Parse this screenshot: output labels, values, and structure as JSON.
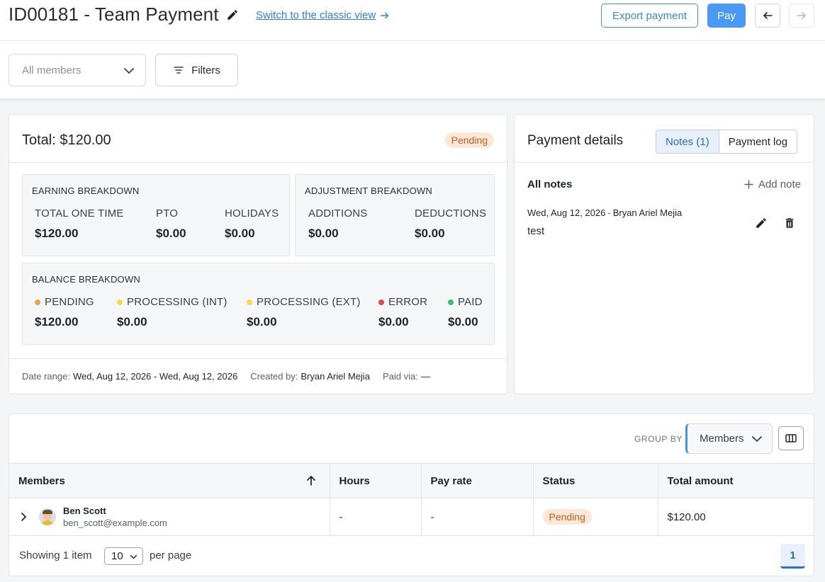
{
  "header": {
    "title": "ID00181 - Team Payment",
    "classic_link": "Switch to the classic view",
    "export_label": "Export payment",
    "pay_label": "Pay"
  },
  "filters": {
    "members_placeholder": "All members",
    "filters_label": "Filters"
  },
  "summary": {
    "total": "Total: $120.00",
    "status": "Pending",
    "earning": {
      "title": "EARNING BREAKDOWN",
      "items": [
        {
          "label": "TOTAL ONE TIME",
          "value": "$120.00"
        },
        {
          "label": "PTO",
          "value": "$0.00"
        },
        {
          "label": "HOLIDAYS",
          "value": "$0.00"
        }
      ]
    },
    "adjustment": {
      "title": "ADJUSTMENT BREAKDOWN",
      "items": [
        {
          "label": "ADDITIONS",
          "value": "$0.00"
        },
        {
          "label": "DEDUCTIONS",
          "value": "$0.00"
        }
      ]
    },
    "balance": {
      "title": "BALANCE BREAKDOWN",
      "items": [
        {
          "label": "PENDING",
          "value": "$120.00",
          "color": "#f0a04b"
        },
        {
          "label": "PROCESSING (INT)",
          "value": "$0.00",
          "color": "#f2dc4a"
        },
        {
          "label": "PROCESSING (EXT)",
          "value": "$0.00",
          "color": "#f2dc4a"
        },
        {
          "label": "ERROR",
          "value": "$0.00",
          "color": "#e04a4a"
        },
        {
          "label": "PAID",
          "value": "$0.00",
          "color": "#3dba7a"
        }
      ]
    },
    "footer": {
      "date_label": "Date range:",
      "date_value": "Wed, Aug 12, 2026 - Wed, Aug 12, 2026",
      "created_label": "Created by:",
      "created_value": "Bryan Ariel Mejia",
      "paid_label": "Paid via:",
      "paid_value": "—"
    }
  },
  "details": {
    "title": "Payment details",
    "tabs": [
      {
        "label": "Notes (1)",
        "active": true
      },
      {
        "label": "Payment log",
        "active": false
      }
    ],
    "all_notes_label": "All notes",
    "add_note_label": "Add note",
    "note": {
      "date": "Wed, Aug 12, 2026",
      "separator": "-",
      "author": "Bryan Ariel Mejia",
      "text": "test"
    }
  },
  "table": {
    "group_by_label": "GROUP BY",
    "group_by_value": "Members",
    "columns": [
      "Members",
      "Hours",
      "Pay rate",
      "Status",
      "Total amount"
    ],
    "rows": [
      {
        "name": "Ben Scott",
        "email": "ben_scott@example.com",
        "hours": "-",
        "pay_rate": "-",
        "status": "Pending",
        "total": "$120.00"
      }
    ],
    "showing": "Showing 1 item",
    "per_page_value": "10",
    "per_page_label": "per page",
    "current_page": "1"
  },
  "colors": {
    "accent": "#4a9af5",
    "pending_bg": "#fde7d6",
    "pending_text": "#c26020"
  }
}
